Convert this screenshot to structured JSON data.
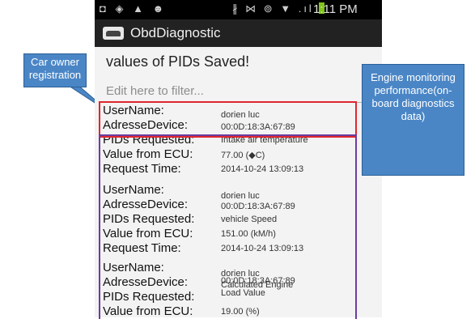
{
  "status_bar": {
    "left_icons": "◘ ◈ ▲ ☻",
    "right_icons": "∦ ⋈ ⊚ ▼ .ıl",
    "time": "1:11 PM"
  },
  "app_bar": {
    "title": "ObdDiagnostic"
  },
  "heading": "values of PIDs Saved!",
  "filter_placeholder": "Edit here to filter...",
  "labels": {
    "username": "UserName:",
    "address": "AdresseDevice:",
    "pids": "PIDs Requested:",
    "value": "Value from ECU:",
    "time": "Request Time:"
  },
  "records": [
    {
      "username": "dorien luc",
      "address": "00:0D:18:3A:67:89",
      "pids": "Intake air temperature",
      "value": "77.00 (◆C)",
      "time": "2014-10-24 13:09:13"
    },
    {
      "username": "dorien luc",
      "address": "00:0D:18:3A:67:89",
      "pids": "vehicle Speed",
      "value": "151.00 (kM/h)",
      "time": "2014-10-24 13:09:13"
    },
    {
      "username": "dorien luc",
      "address": "00:0D:18:3A:67:89",
      "pids": "Calculated Engine Load Value",
      "value": "19.00 (%)"
    }
  ],
  "callouts": {
    "owner": "Car owner registration",
    "engine": "Engine monitoring performance(on-board diagnostics data)"
  },
  "colors": {
    "owner_box": "#e0262e",
    "engine_box": "#6a3ea1",
    "callout_fill": "#4a86c6"
  }
}
